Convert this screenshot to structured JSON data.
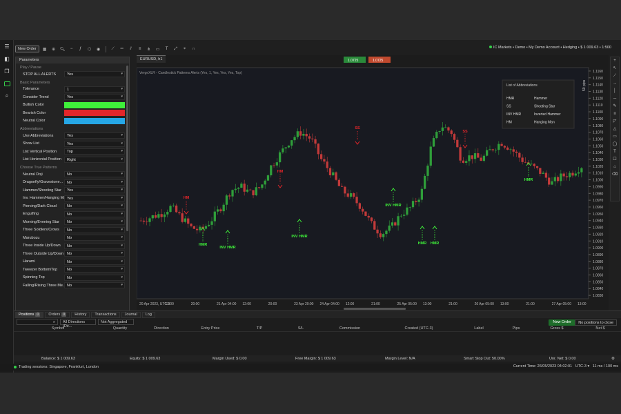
{
  "toolbar": {
    "new_order": "New Order",
    "account": "IC Markets • Demo • My Demo Account • Hedging • $ 1 009.63 • 1:500"
  },
  "params": {
    "title": "Parameters",
    "sections": {
      "play_pause": "Play / Pause",
      "basic": "Basic Parameters",
      "abbreviations": "Abbreviations",
      "choose": "Choose True Patterns"
    },
    "stop_all_alerts": {
      "label": "STOP ALL ALERTS",
      "value": "Yes"
    },
    "basic": [
      {
        "label": "Tolerance",
        "value": "1"
      },
      {
        "label": "Consider Trend",
        "value": "Yes"
      },
      {
        "label": "Bullish Color",
        "value": "",
        "color": "#3ff03a"
      },
      {
        "label": "Bearish Color",
        "value": "",
        "color": "#e3262a"
      },
      {
        "label": "Neutral Color",
        "value": "",
        "color": "#26a7e6"
      }
    ],
    "abbrev": [
      {
        "label": "Use Abbreviations",
        "value": "Yes"
      },
      {
        "label": "Show List",
        "value": "Yes"
      },
      {
        "label": "List Vertical Position",
        "value": "Top"
      },
      {
        "label": "List Horizontal Position",
        "value": "Right"
      }
    ],
    "patterns": [
      {
        "label": "Neutral Doji",
        "value": "No"
      },
      {
        "label": "Dragonfly/Gravestone...",
        "value": "No"
      },
      {
        "label": "Hammer/Shooting Star",
        "value": "Yes"
      },
      {
        "label": "Inv. Hammer/Hanging Man",
        "value": "Yes"
      },
      {
        "label": "Piercing/Dark Cloud",
        "value": "No"
      },
      {
        "label": "Engulfing",
        "value": "No"
      },
      {
        "label": "Morning/Evening Star",
        "value": "No"
      },
      {
        "label": "Three Soldiers/Crows",
        "value": "No"
      },
      {
        "label": "Marubozu",
        "value": "No"
      },
      {
        "label": "Three Inside Up/Down",
        "value": "No"
      },
      {
        "label": "Three Outside Up/Down",
        "value": "No"
      },
      {
        "label": "Harami",
        "value": "No"
      },
      {
        "label": "Tweezer Bottom/Top",
        "value": "No"
      },
      {
        "label": "Spinning Top",
        "value": "No"
      },
      {
        "label": "Falling/Rising Three Me...",
        "value": "No"
      }
    ]
  },
  "chart": {
    "tab": "EURUSD, h1",
    "indicator": "VergeXLR - Candlestick Patterns Alerts (Yes, 1, Yes, Yes, Yes, Top)",
    "sell_price": "1.0725",
    "sell_suffix": "6",
    "buy_price": "1.0725",
    "buy_suffix": "7",
    "zoom": "50 pips",
    "abbrev_title": "List of Abbreviations",
    "abbrev_list": [
      {
        "k": "HMR",
        "v": "Hammer"
      },
      {
        "k": "SS",
        "v": "Shooting Star"
      },
      {
        "k": "INV HMR",
        "v": "Inverted Hammer"
      },
      {
        "k": "HM",
        "v": "Hanging Man"
      }
    ],
    "price_ticks": [
      "1.1160",
      "1.1150",
      "1.1140",
      "1.1130",
      "1.1120",
      "1.1110",
      "1.1100",
      "1.1090",
      "1.1080",
      "1.1070",
      "1.1060",
      "1.1050",
      "1.1040",
      "1.1030",
      "1.1020",
      "1.1010",
      "1.1000",
      "1.0990",
      "1.0980",
      "1.0970",
      "1.0960",
      "1.0950",
      "1.0940",
      "1.0930",
      "1.0920",
      "1.0910",
      "1.0900",
      "1.0890",
      "1.0880",
      "1.0870",
      "1.0860",
      "1.0850",
      "1.0840",
      "1.0830"
    ],
    "time_ticks": [
      "20 Apr 2023, UTC-3",
      "12:00",
      "20:00",
      "21 Apr 04:00",
      "12:00",
      "20:00",
      "23 Apr 20:00",
      "24 Apr 04:00",
      "12:00",
      "21:00",
      "25 Apr 05:00",
      "13:00",
      "21:00",
      "26 Apr 05:00",
      "13:00",
      "21:00",
      "27 Apr 05:00",
      "13:00"
    ],
    "labels": [
      {
        "text": "HM",
        "kind": "bear"
      },
      {
        "text": "HMR",
        "kind": "bull"
      },
      {
        "text": "INV HMR",
        "kind": "bull"
      },
      {
        "text": "HM",
        "kind": "bear"
      },
      {
        "text": "INV HMR",
        "kind": "bull"
      },
      {
        "text": "SS",
        "kind": "bear"
      },
      {
        "text": "INV HMR",
        "kind": "bull"
      },
      {
        "text": "HMR",
        "kind": "bull"
      },
      {
        "text": "HMR",
        "kind": "bull"
      },
      {
        "text": "SS",
        "kind": "bear"
      },
      {
        "text": "HMR",
        "kind": "bull"
      }
    ]
  },
  "chart_data": {
    "type": "candlestick",
    "x": "hourly bars 20 Apr 2023 – 27 Apr 2023 (UTC-3)",
    "ylim": [
      1.0825,
      1.1165
    ],
    "close_path": [
      1.094,
      1.0945,
      1.095,
      1.096,
      1.0945,
      1.093,
      1.0925,
      1.094,
      1.096,
      1.0985,
      1.099,
      1.098,
      1.099,
      1.102,
      1.104,
      1.106,
      1.107,
      1.106,
      1.103,
      1.101,
      1.0985,
      1.0975,
      1.096,
      1.0935,
      1.092,
      1.093,
      1.095,
      1.096,
      1.098,
      1.105,
      1.108,
      1.107,
      1.103,
      1.1035,
      1.103,
      1.1045,
      1.1055,
      1.1045,
      1.103,
      1.102,
      1.101,
      1.0995,
      1.1005,
      1.101,
      1.102
    ]
  },
  "bottom": {
    "tabs": [
      {
        "label": "Positions",
        "count": "0"
      },
      {
        "label": "Orders",
        "count": "0"
      },
      {
        "label": "History",
        "count": ""
      },
      {
        "label": "Transactions",
        "count": ""
      },
      {
        "label": "Journal",
        "count": ""
      },
      {
        "label": "Log",
        "count": ""
      }
    ],
    "filter_directions": "All Directions (De...",
    "filter_aggregated": "Not Aggregated",
    "new_order": "New Order",
    "no_positions": "No positions to close",
    "columns": [
      "Symbol",
      "Quantity",
      "Direction",
      "Entry Price",
      "T/P",
      "S/L",
      "Commission",
      "Created (UTC-3)",
      "Label",
      "Pips",
      "Gross $",
      "Net $"
    ],
    "footer": {
      "balance": "Balance: $ 1 009.63",
      "equity": "Equity: $ 1 009.63",
      "margin_used": "Margin Used: $ 0.00",
      "free_margin": "Free Margin: $ 1 009.63",
      "margin_level": "Margin Level: N/A",
      "stop_out": "Smart Stop Out: 50.00%",
      "unr_net": "Unr. Net: $ 0.00"
    }
  },
  "status": {
    "sessions": "Trading sessions: Singapore, Frankfurt, London",
    "current_time": "Current Time: 26/05/2023 04:02:01",
    "tz": "UTC-3",
    "latency": "11 ms / 100 ms"
  }
}
